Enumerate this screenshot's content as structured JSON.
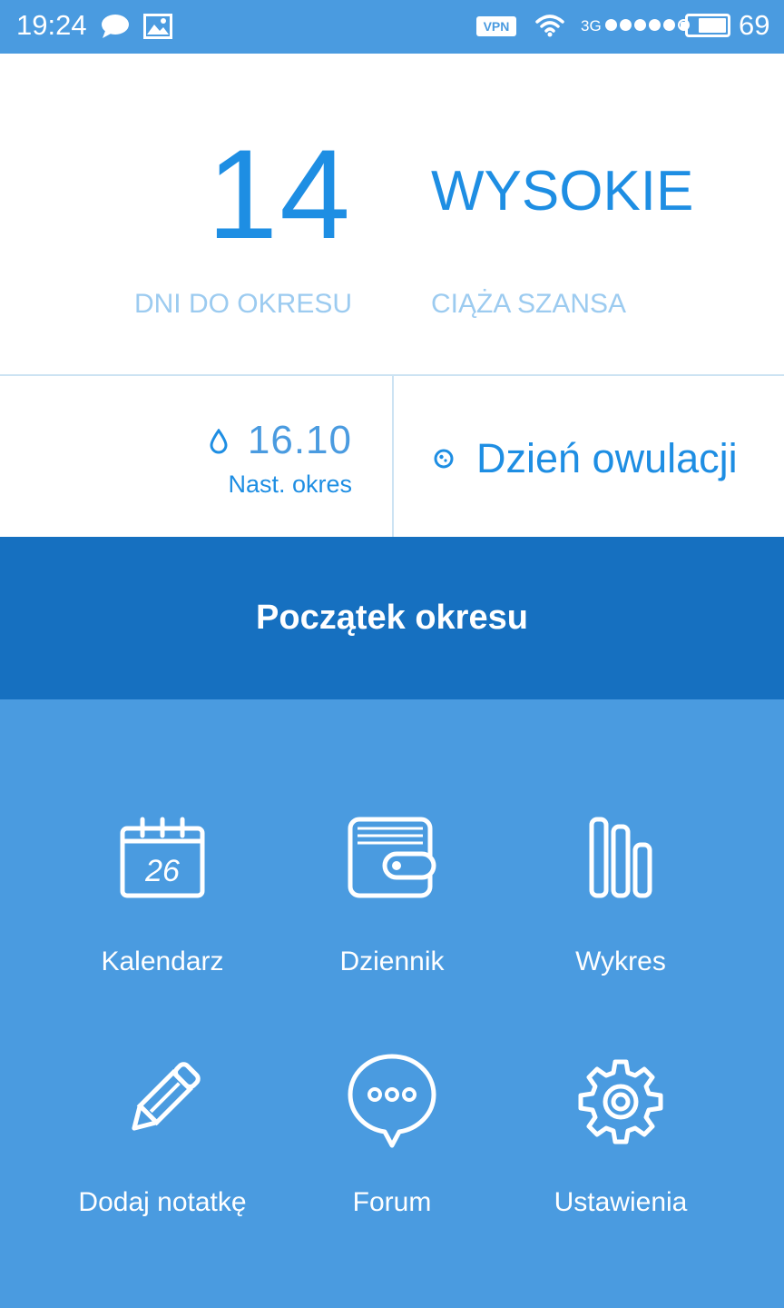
{
  "status_bar": {
    "time": "19:24",
    "vpn": "VPN",
    "network": "3G",
    "battery_level": "69",
    "signal_bars_filled": 5,
    "signal_bars_total": 6,
    "icons": [
      "chat-bubble-icon",
      "image-icon",
      "wifi-icon",
      "battery-icon"
    ]
  },
  "summary": {
    "days_value": "14",
    "days_label": "DNI DO OKRESU",
    "chance_value": "WYSOKIE",
    "chance_label": "CIĄŻA SZANSA"
  },
  "info": {
    "next_period_date": "16.10",
    "next_period_label": "Nast. okres",
    "ovulation_label": "Dzień owulacji",
    "icons": [
      "drop-icon",
      "ovulation-icon"
    ]
  },
  "action": {
    "period_start_label": "Początek okresu"
  },
  "menu": {
    "items": [
      {
        "label": "Kalendarz",
        "icon": "calendar-icon",
        "calendar_day": "26"
      },
      {
        "label": "Dziennik",
        "icon": "diary-icon"
      },
      {
        "label": "Wykres",
        "icon": "chart-icon"
      },
      {
        "label": "Dodaj notatkę",
        "icon": "pencil-icon"
      },
      {
        "label": "Forum",
        "icon": "forum-icon"
      },
      {
        "label": "Ustawienia",
        "icon": "settings-gear-icon"
      }
    ]
  },
  "colors": {
    "status_bar": "#4a9be0",
    "primary_text": "#1e8ee3",
    "muted_label": "#9ccbf0",
    "action_button": "#1670c0",
    "menu_background": "#4a9be0",
    "divider": "#cce3f3"
  }
}
